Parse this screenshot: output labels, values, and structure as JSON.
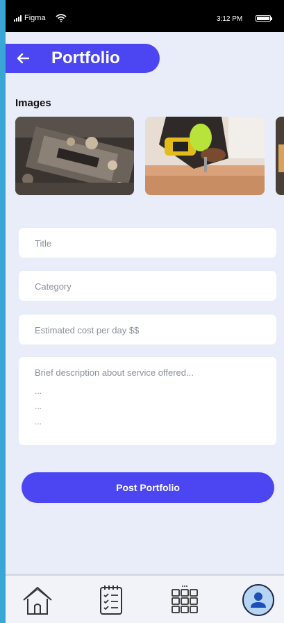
{
  "status_bar": {
    "carrier": "Figma",
    "time": "3:12 PM"
  },
  "header": {
    "title": "Portfolio"
  },
  "images_section": {
    "label": "Images"
  },
  "form": {
    "title_placeholder": "Title",
    "category_placeholder": "Category",
    "cost_placeholder": "Estimated cost per day $$",
    "description_placeholder": "Brief description about service offered...",
    "description_extra_lines": [
      "...",
      "...",
      "..."
    ]
  },
  "post_button": {
    "label": "Post Portfolio"
  },
  "bottom_nav": {
    "items": [
      {
        "icon": "home-icon"
      },
      {
        "icon": "checklist-icon"
      },
      {
        "icon": "grid-icon"
      },
      {
        "icon": "profile-icon"
      }
    ]
  },
  "colors": {
    "accent": "#4b46f2",
    "background": "#e9edf9",
    "field": "#ffffff",
    "placeholder": "#8a8f9c"
  }
}
